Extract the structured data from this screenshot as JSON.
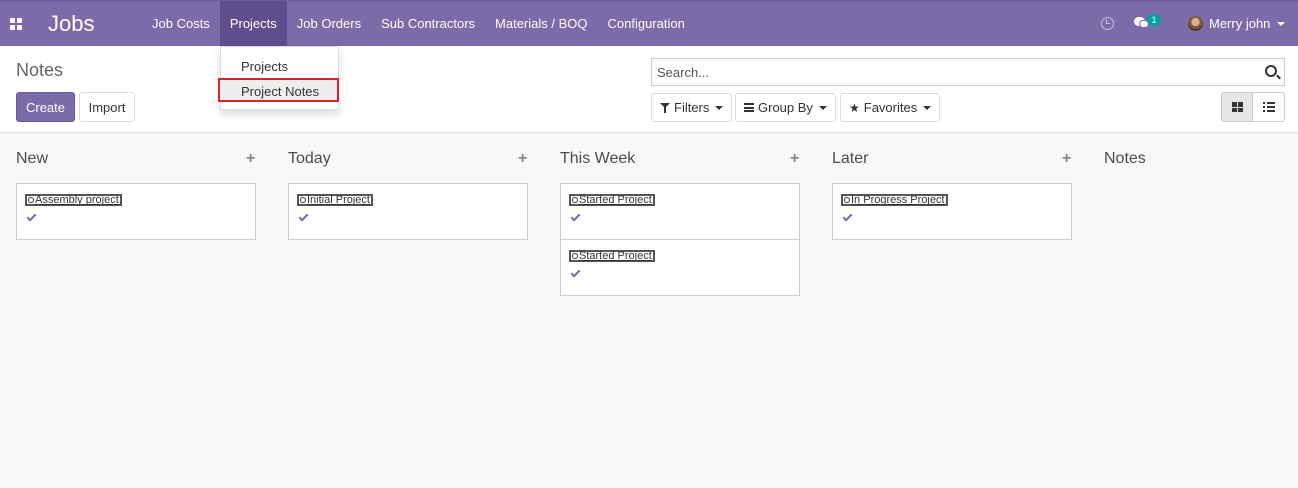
{
  "app": {
    "brand": "Jobs",
    "menu": [
      "Job Costs",
      "Projects",
      "Job Orders",
      "Sub Contractors",
      "Materials / BOQ",
      "Configuration"
    ],
    "active_menu": "Projects",
    "chat_badge": "1",
    "user": "Merry john"
  },
  "dropdown": {
    "items": [
      "Projects",
      "Project Notes"
    ],
    "highlighted": "Project Notes"
  },
  "control": {
    "breadcrumb": "Notes",
    "create_label": "Create",
    "import_label": "Import",
    "search_placeholder": "Search...",
    "filters_label": "Filters",
    "groupby_label": "Group By",
    "favorites_label": "Favorites"
  },
  "kanban": {
    "columns": [
      {
        "title": "New",
        "cards": [
          "Assembly project"
        ]
      },
      {
        "title": "Today",
        "cards": [
          "Initial Project"
        ]
      },
      {
        "title": "This Week",
        "cards": [
          "Started Project",
          "Started Project"
        ]
      },
      {
        "title": "Later",
        "cards": [
          "In Progress Project"
        ]
      },
      {
        "title": "Notes",
        "cards": []
      }
    ],
    "add_symbol": "+"
  },
  "colors": {
    "navbar": "#7c6ba9",
    "active_menu": "#5e4e8e",
    "highlight_border": "#d9232b",
    "badge": "#00a09d"
  }
}
